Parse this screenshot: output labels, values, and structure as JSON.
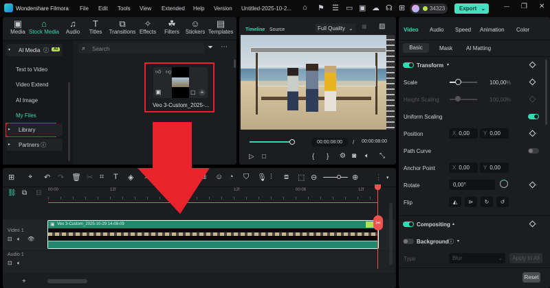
{
  "app": {
    "name": "Wondershare Filmora",
    "project_title": "Untitled-2025-10-2...",
    "credits": "34323",
    "export_label": "Export"
  },
  "menu": [
    "File",
    "Edit",
    "Tools",
    "View",
    "Extended",
    "Help",
    "Version"
  ],
  "media_tabs": [
    {
      "label": "Media",
      "icon": "media-icon",
      "glyph": "▣"
    },
    {
      "label": "Stock Media",
      "icon": "stock-media-icon",
      "glyph": "⌂"
    },
    {
      "label": "Audio",
      "icon": "audio-icon",
      "glyph": "♫"
    },
    {
      "label": "Titles",
      "icon": "titles-icon",
      "glyph": "T"
    },
    {
      "label": "Transitions",
      "icon": "transitions-icon",
      "glyph": "⧉"
    },
    {
      "label": "Effects",
      "icon": "effects-icon",
      "glyph": "✧"
    },
    {
      "label": "Filters",
      "icon": "filters-icon",
      "glyph": "☘"
    },
    {
      "label": "Stickers",
      "icon": "stickers-icon",
      "glyph": "☺"
    },
    {
      "label": "Templates",
      "icon": "templates-icon",
      "glyph": "▤"
    }
  ],
  "sidebar": {
    "ai_media": "AI Media",
    "ai_badge": "AI",
    "items": [
      "Text to Video",
      "Video Extend",
      "AI Image",
      "My Files"
    ],
    "library": "Library",
    "partners": "Partners"
  },
  "search": {
    "placeholder": "Search"
  },
  "media_item": {
    "name": "Veo 3-Custom_2025-..."
  },
  "preview": {
    "tab_timeline": "Timeline",
    "tab_source": "Source",
    "quality": "Full Quality",
    "current_time": "00:00:08:00",
    "separator": "/",
    "total_time": "00:00:08:00",
    "progress": 1.0
  },
  "props": {
    "tabs": [
      "Video",
      "Audio",
      "Speed",
      "Animation",
      "Color"
    ],
    "subtabs": [
      "Basic",
      "Mask",
      "AI Matting"
    ],
    "transform": "Transform",
    "scale_label": "Scale",
    "scale_value": "100,00",
    "pct": "%",
    "height_scaling_label": "Height Scaling",
    "height_scaling_value": "100,00",
    "uniform_scaling": "Uniform Scaling",
    "position": "Position",
    "pos_x": "0,00",
    "pos_y": "0,00",
    "x": "X",
    "y": "Y",
    "path_curve": "Path Curve",
    "anchor_point": "Anchor Point",
    "anchor_x": "0,00",
    "anchor_y": "0,00",
    "rotate": "Rotate",
    "rotate_value": "0,00°",
    "flip": "Flip",
    "compositing": "Compositing",
    "background": "Background",
    "type_label": "Type",
    "type_value": "Blur",
    "apply_all": "Apply to All",
    "reset": "Reset"
  },
  "timeline": {
    "ruler": [
      "00:00",
      "12f",
      "12f",
      "00:06",
      "12f"
    ],
    "clip_name": "Veo 3-Custom_2025-10-29 14-08-09",
    "tracks": [
      "Video 1",
      "Audio 1"
    ],
    "add": "+"
  },
  "colors": {
    "accent": "#38d9b0",
    "annotation": "#e8232b",
    "clip": "#23876b",
    "playhead": "#ef5350"
  }
}
